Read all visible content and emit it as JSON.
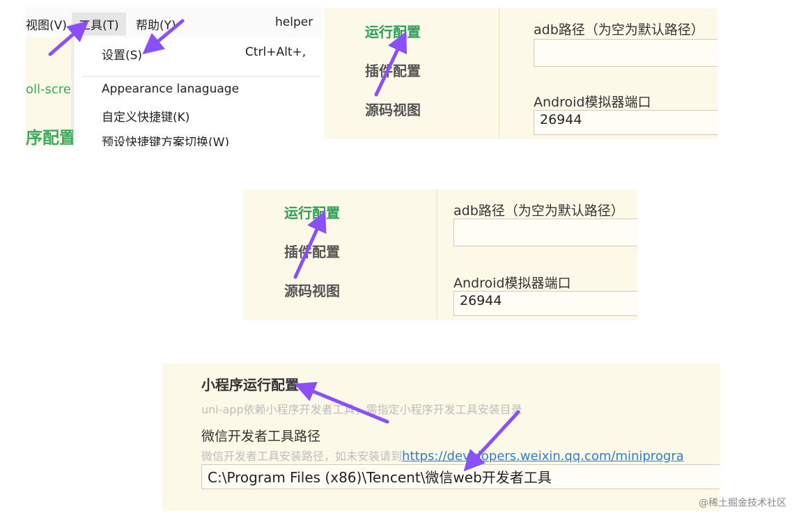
{
  "menu_panel": {
    "menubar": [
      "视图(V)",
      "工具(T)",
      "帮助(Y)",
      "helper"
    ],
    "left_strip": [
      "oll-scre",
      "序配置"
    ],
    "dropdown": [
      {
        "label": "设置(S)",
        "shortcut": "Ctrl+Alt+,"
      },
      {
        "label": "Appearance lanaguage",
        "shortcut": ""
      },
      {
        "label": "自定义快捷键(K)",
        "shortcut": ""
      },
      {
        "label": "预设快捷键方案切换(W)",
        "shortcut": ""
      }
    ]
  },
  "run_config": {
    "nav": [
      "运行配置",
      "插件配置",
      "源码视图"
    ],
    "adb_label": "adb路径（为空为默认路径）",
    "adb_value": "",
    "port_label": "Android模拟器端口",
    "port_value": "26944"
  },
  "mini_program": {
    "title": "小程序运行配置",
    "hint": "uni-app依赖小程序开发者工具，需指定小程序开发工具安装目录",
    "path_label": "微信开发者工具路径",
    "path_hint": "微信开发者工具安装路径，如未安装请到",
    "path_link": "https://developers.weixin.qq.com/miniprogra",
    "path_value": "C:\\Program Files (x86)\\Tencent\\微信web开发者工具"
  },
  "watermark": "@稀土掘金技术社区",
  "colors": {
    "arrow": "#8a4fff",
    "active_nav": "#2f9f55",
    "panel_bg": "#fcf9e8",
    "link": "#2d7dd2"
  }
}
